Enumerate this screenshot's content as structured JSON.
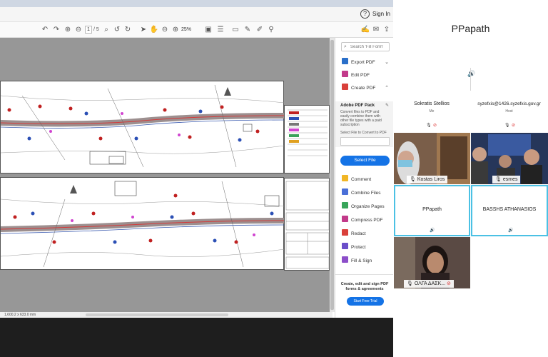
{
  "acrobat": {
    "help_glyph": "?",
    "sign_in": "Sign In",
    "page_current": "1",
    "page_total": "/ 5",
    "zoom": "25%",
    "status_dimensions": "1,600.2 x 633.0 mm"
  },
  "tools_pane": {
    "find_placeholder": "Search 'Fill Form'",
    "items_top": [
      {
        "label": "Export PDF",
        "color": "#2a6fc9",
        "chevron": "⌄"
      },
      {
        "label": "Edit PDF",
        "color": "#c23a8a",
        "chevron": ""
      },
      {
        "label": "Create PDF",
        "color": "#d9403a",
        "chevron": "⌃"
      }
    ],
    "pack_title": "Adobe PDF Pack",
    "pack_desc": "Convert files to PDF and easily combine them with other file types with a paid subscription",
    "select_label": "Select File to Convert to PDF",
    "select_button": "Select File",
    "tools": [
      {
        "label": "Comment",
        "color": "#f1b625"
      },
      {
        "label": "Combine Files",
        "color": "#4a6fd8"
      },
      {
        "label": "Organize Pages",
        "color": "#38a55a"
      },
      {
        "label": "Compress PDF",
        "color": "#c23a8a"
      },
      {
        "label": "Redact",
        "color": "#d9403a"
      },
      {
        "label": "Protect",
        "color": "#6a4ec9"
      },
      {
        "label": "Fill & Sign",
        "color": "#8c4ec9"
      }
    ],
    "promo_text": "Create, edit and sign PDF forms & agreements",
    "free_trial": "Start Free Trial"
  },
  "conference": {
    "meeting_title": "PPapath",
    "participants": [
      {
        "name": "Sokratis Stellios",
        "role": "Me"
      },
      {
        "name": "syzefxis@1426.syzefxis.gov.gr",
        "role": "Host"
      },
      {
        "name": "Kostas Liros"
      },
      {
        "name": "esmes"
      },
      {
        "name": "PPapath"
      },
      {
        "name": "BASSHS ATHANASIOS"
      },
      {
        "name": "ΟΛΓΑ ΔΑΣΚ..."
      }
    ],
    "accent_color": "#4bc1e4"
  }
}
